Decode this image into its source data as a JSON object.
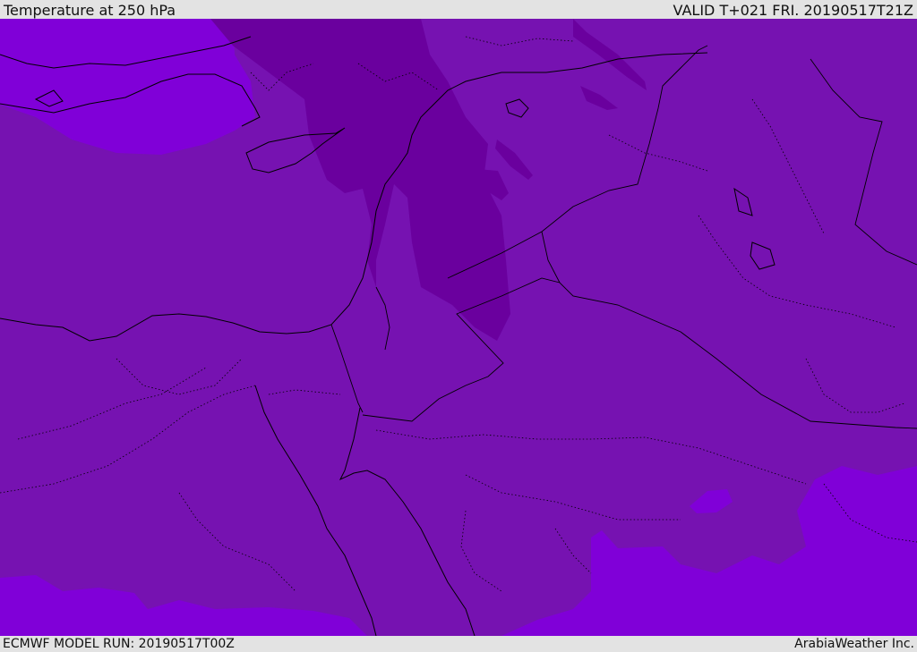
{
  "header": {
    "title": "Temperature at 250 hPa",
    "valid": "VALID T+021 FRI. 20190517T21Z"
  },
  "footer": {
    "model_run": "ECMWF MODEL RUN: 20190517T00Z",
    "credit": "ArabiaWeather Inc."
  },
  "map": {
    "field": "temperature",
    "level": "250 hPa",
    "colors": {
      "background_band": "#7612b1",
      "warm_band": "#8000d8",
      "cold_band": "#6a009e",
      "coastline": "#000000",
      "border": "#000000"
    }
  }
}
